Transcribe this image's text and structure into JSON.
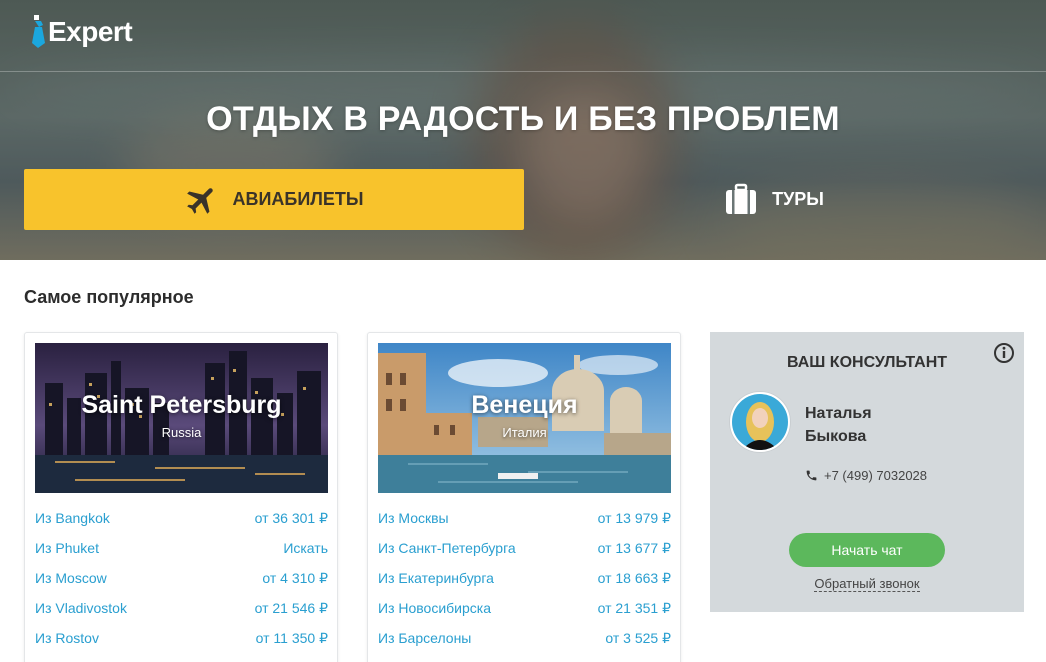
{
  "brand": {
    "logo_text": "Expert",
    "accent": "#1ba7de"
  },
  "hero": {
    "title": "ОТДЫХ В РАДОСТЬ И БЕЗ ПРОБЛЕМ",
    "tabs": [
      {
        "label": "АВИАБИЛЕТЫ",
        "icon": "airplane-icon",
        "active": true,
        "color": "#f8c32c"
      },
      {
        "label": "ТУРЫ",
        "icon": "suitcase-icon",
        "active": false
      }
    ]
  },
  "popular": {
    "title": "Самое популярное",
    "cards": [
      {
        "city": "Saint Petersburg",
        "country": "Russia",
        "routes": [
          {
            "from": "Из Bangkok",
            "price": "от 36 301 ₽"
          },
          {
            "from": "Из Phuket",
            "price": "Искать"
          },
          {
            "from": "Из Moscow",
            "price": "от 4 310 ₽"
          },
          {
            "from": "Из Vladivostok",
            "price": "от 21 546 ₽"
          },
          {
            "from": "Из Rostov",
            "price": "от 11 350 ₽"
          }
        ]
      },
      {
        "city": "Венеция",
        "country": "Италия",
        "routes": [
          {
            "from": "Из Москвы",
            "price": "от 13 979 ₽"
          },
          {
            "from": "Из Санкт-Петербурга",
            "price": "от 13 677 ₽"
          },
          {
            "from": "Из Екатеринбурга",
            "price": "от 18 663 ₽"
          },
          {
            "from": "Из Новосибирска",
            "price": "от 21 351 ₽"
          },
          {
            "from": "Из Барселоны",
            "price": "от 3 525 ₽"
          }
        ]
      }
    ]
  },
  "consultant": {
    "title": "ВАШ КОНСУЛЬТАНТ",
    "first_name": "Наталья",
    "last_name": "Быкова",
    "phone": "+7 (499) 7032028",
    "chat_button": "Начать чат",
    "callback_link": "Обратный звонок",
    "chat_color": "#5cb85c"
  },
  "colors": {
    "link": "#2a9fd0",
    "panel": "#d4d9dc"
  }
}
